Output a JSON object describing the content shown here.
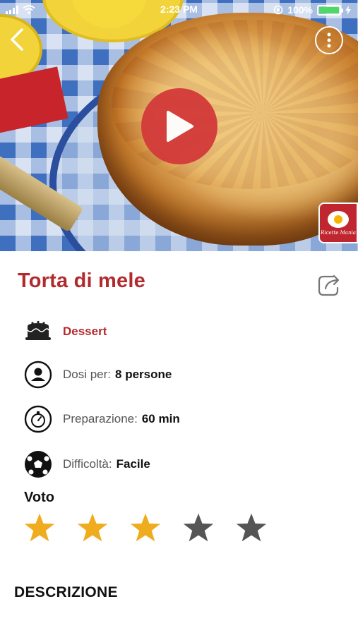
{
  "status_bar": {
    "time": "2:23 PM",
    "battery": "100%"
  },
  "hero": {
    "badge_text": "Ricette Mania"
  },
  "recipe": {
    "title": "Torta di mele",
    "category": "Dessert",
    "servings_label": "Dosi per:",
    "servings_value": "8 persone",
    "prep_label": "Preparazione:",
    "prep_value": "60 min",
    "difficulty_label": "Difficoltà:",
    "difficulty_value": "Facile"
  },
  "rating": {
    "label": "Voto",
    "value": 3,
    "max": 5
  },
  "description": {
    "title": "DESCRIZIONE"
  },
  "colors": {
    "accent": "#b22a2e",
    "star_filled": "#f0ac1f",
    "star_empty": "#555555",
    "play_button": "#d33a3a"
  },
  "icons": {
    "back": "chevron-left-icon",
    "more": "more-vertical-icon",
    "play": "play-icon",
    "share": "share-icon",
    "category": "cake-icon",
    "servings": "person-icon",
    "prep": "timer-icon",
    "difficulty": "ball-icon"
  }
}
